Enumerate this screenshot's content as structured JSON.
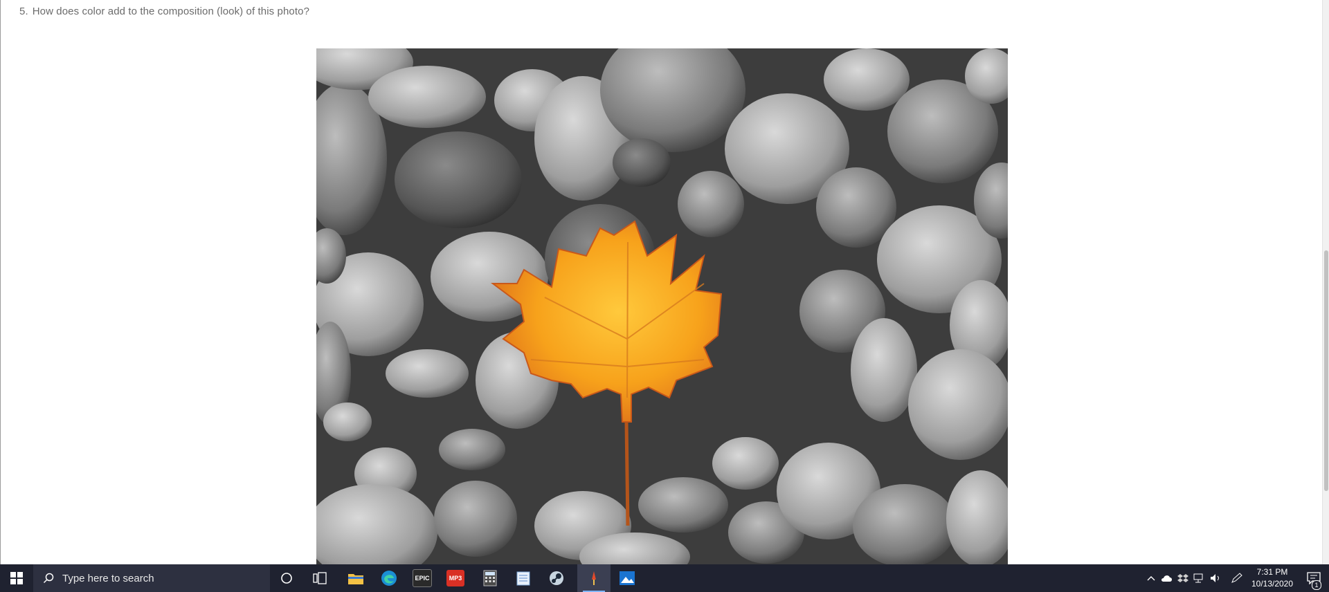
{
  "question": {
    "number": "5.",
    "text": "How does color add to the composition (look) of this photo?"
  },
  "photo": {
    "subject": "orange maple leaf on grey pebbles",
    "leaf_color": "#f5a623",
    "stone_palette": "grayscale"
  },
  "taskbar": {
    "search_placeholder": "Type here to search",
    "apps": [
      {
        "name": "cortana",
        "icon": "circle-icon"
      },
      {
        "name": "task-view",
        "icon": "task-view-icon"
      },
      {
        "name": "file-explorer",
        "icon": "folder-icon"
      },
      {
        "name": "edge",
        "icon": "edge-icon"
      },
      {
        "name": "epic-games",
        "icon": "epic-games-icon",
        "label": "EPIC"
      },
      {
        "name": "mp3-app",
        "icon": "mp3-icon",
        "label": "MP3"
      },
      {
        "name": "calculator",
        "icon": "calculator-icon"
      },
      {
        "name": "notepad",
        "icon": "notepad-icon"
      },
      {
        "name": "steam",
        "icon": "steam-icon"
      },
      {
        "name": "paint-app",
        "icon": "paint-icon",
        "active": true
      },
      {
        "name": "photos",
        "icon": "photos-icon"
      }
    ],
    "clock": {
      "time": "7:31 PM",
      "date": "10/13/2020"
    },
    "notifications_count": "1",
    "accent_color": "#7fb5ff"
  }
}
